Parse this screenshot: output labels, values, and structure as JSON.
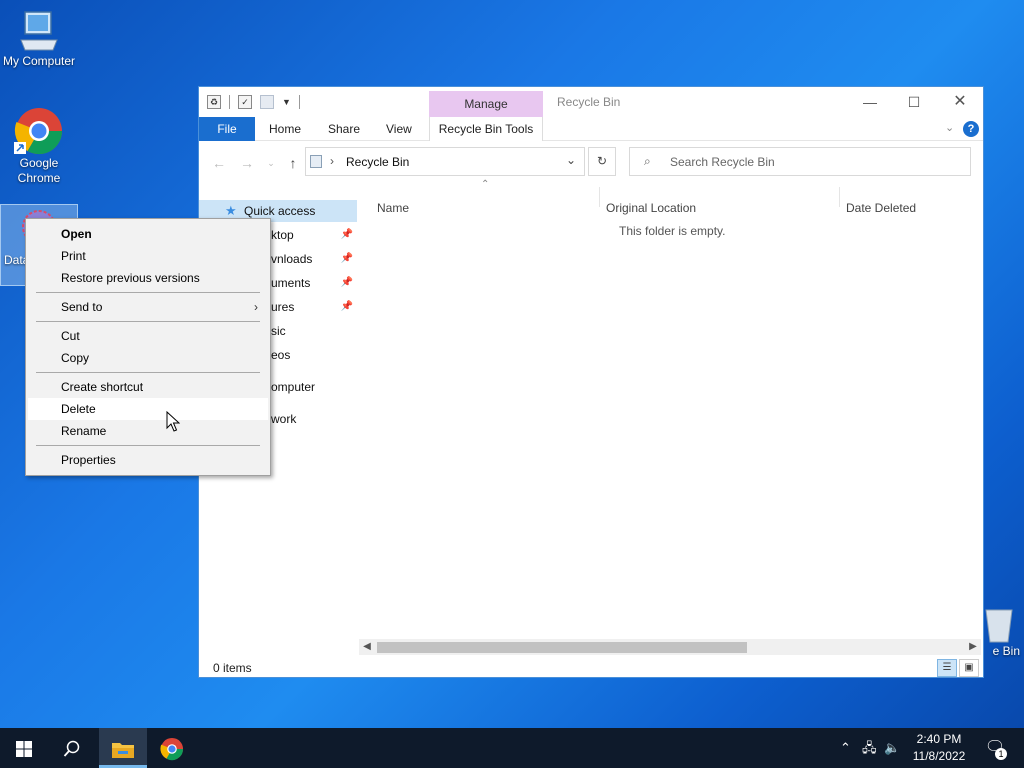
{
  "desktop": {
    "icons": [
      {
        "label": "My Computer"
      },
      {
        "label": "Google Chrome"
      },
      {
        "label": "Data"
      },
      {
        "label": "e Bin"
      }
    ]
  },
  "explorer": {
    "manage_tab": "Manage",
    "title": "Recycle Bin",
    "ribbon_tabs": [
      "File",
      "Home",
      "Share",
      "View",
      "Recycle Bin Tools"
    ],
    "address": "Recycle Bin",
    "search_placeholder": "Search Recycle Bin",
    "nav_items": [
      {
        "label": "Quick access"
      },
      {
        "label": "ktop"
      },
      {
        "label": "vnloads"
      },
      {
        "label": "uments"
      },
      {
        "label": "ures"
      },
      {
        "label": "sic"
      },
      {
        "label": "eos"
      },
      {
        "label": "omputer"
      },
      {
        "label": "work"
      }
    ],
    "columns": [
      "Name",
      "Original Location",
      "Date Deleted"
    ],
    "empty_message": "This folder is empty.",
    "status": "0 items"
  },
  "context_menu": {
    "items": [
      {
        "label": "Open"
      },
      {
        "label": "Print"
      },
      {
        "label": "Restore previous versions"
      },
      {
        "label": "Send to"
      },
      {
        "label": "Cut"
      },
      {
        "label": "Copy"
      },
      {
        "label": "Create shortcut"
      },
      {
        "label": "Delete"
      },
      {
        "label": "Rename"
      },
      {
        "label": "Properties"
      }
    ]
  },
  "taskbar": {
    "time": "2:40 PM",
    "date": "11/8/2022",
    "notification_count": "1"
  },
  "colors": {
    "accent": "#1a6ecf",
    "manage_tab": "#e8c7f0",
    "taskbar": "#0e1a2b"
  }
}
